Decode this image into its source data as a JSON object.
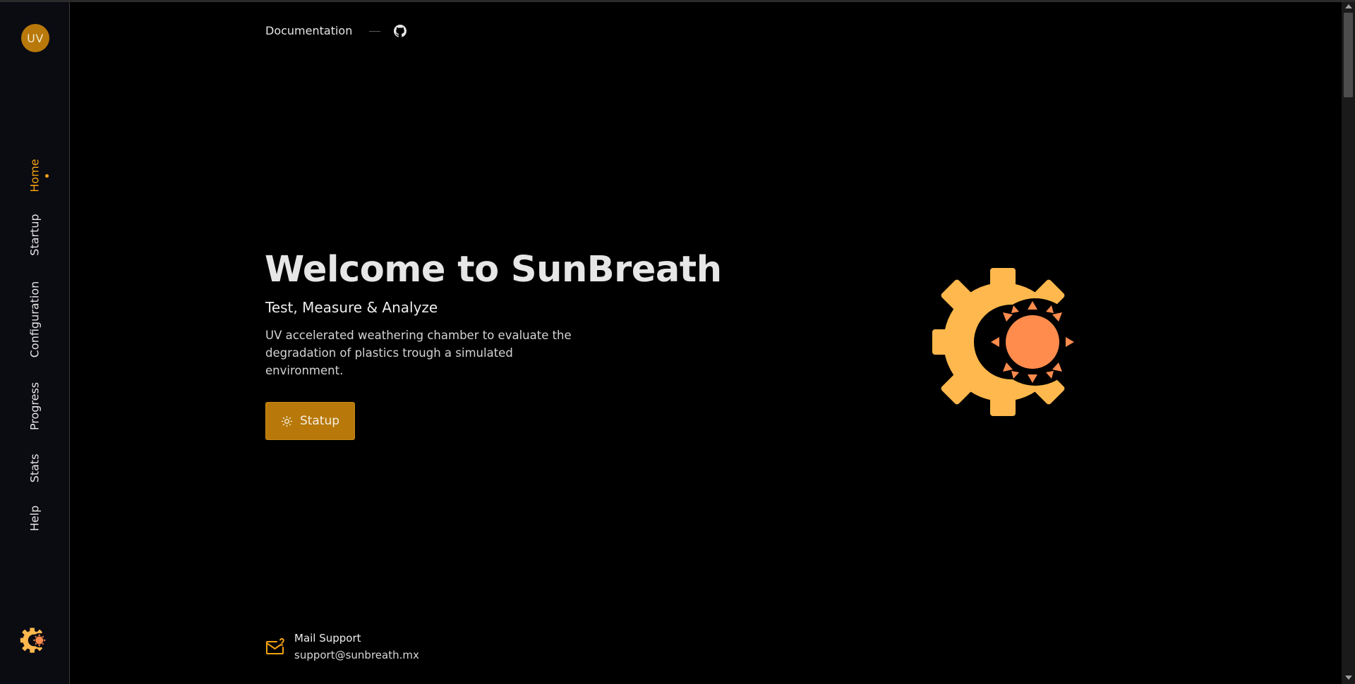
{
  "app": {
    "avatar_text": "UV",
    "accent_color": "#b8790a",
    "active_color": "#f2a313"
  },
  "sidebar": {
    "items": [
      {
        "label": "Home",
        "active": true
      },
      {
        "label": "Startup",
        "active": false
      },
      {
        "label": "Configuration",
        "active": false
      },
      {
        "label": "Progress",
        "active": false
      },
      {
        "label": "Stats",
        "active": false
      },
      {
        "label": "Help",
        "active": false
      }
    ],
    "logo_icon": "gear-sun-icon"
  },
  "topnav": {
    "documentation_label": "Documentation",
    "github_icon": "github-icon"
  },
  "hero": {
    "title": "Welcome to SunBreath",
    "subtitle": "Test, Measure & Analyze",
    "description": "UV accelerated weathering chamber to evaluate the degradation of plastics trough a simulated environment.",
    "button_label": "Statup",
    "button_icon": "sun-icon",
    "illustration": "gear-sun-icon"
  },
  "support": {
    "icon": "mail-question-icon",
    "title": "Mail Support",
    "email": "support@sunbreath.mx"
  }
}
